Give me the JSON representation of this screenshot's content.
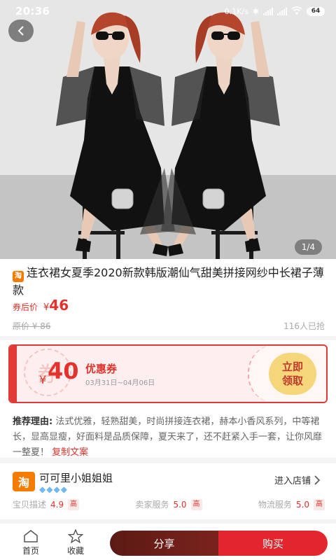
{
  "status_bar": {
    "time": "20:36",
    "net_speed": "0.1K/s",
    "battery": "64"
  },
  "gallery": {
    "indicator": "1/4"
  },
  "product": {
    "title": "连衣裙女夏季2020新款韩版潮仙气甜美拼接网纱中长裙子薄款",
    "price_label": "券后价",
    "currency": "¥",
    "price": "46",
    "original_price": "原价 ¥ 86",
    "sold": "116人已抢"
  },
  "coupon": {
    "stamp": "券",
    "currency": "¥",
    "amount": "40",
    "title": "优惠券",
    "date_range": "03月31日~04月06日",
    "claim_line1": "立即",
    "claim_line2": "领取"
  },
  "recommend": {
    "label": "推荐理由:",
    "text": "法式优雅，轻熟甜美，时尚拼接连衣裙，赫本小香风系列，中等裙长，显高显瘦，好面料是品质保障，夏天来了，还不赶紧入手一套，让你风靡一整夏！",
    "copy_label": "复制文案"
  },
  "shop": {
    "logo": "淘",
    "name": "可可里小姐姐姐",
    "enter_label": "进入店铺",
    "ratings": [
      {
        "label": "宝贝描述",
        "value": "4.9",
        "level": "高"
      },
      {
        "label": "卖家服务",
        "value": "5.0",
        "level": "高"
      },
      {
        "label": "物流服务",
        "value": "5.0",
        "level": "高"
      }
    ]
  },
  "bottom_bar": {
    "home": "首页",
    "favorite": "收藏",
    "share": "分享",
    "buy": "购买"
  },
  "colors": {
    "accent": "#e2322b",
    "buy_button": "#e3262e",
    "share_button": "#6a1f18",
    "taobao_orange": "#f57c00"
  }
}
